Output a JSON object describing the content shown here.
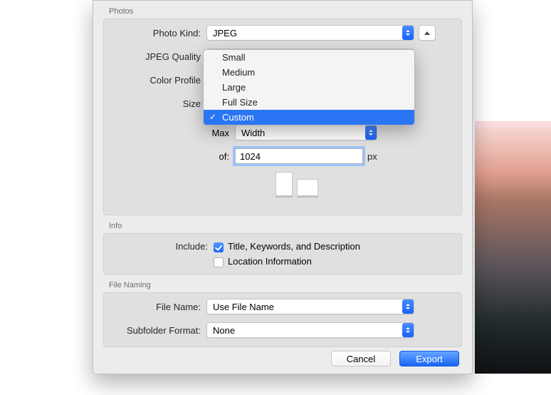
{
  "sections": {
    "photos": "Photos",
    "info": "Info",
    "fileNaming": "File Naming"
  },
  "photos": {
    "photoKindLabel": "Photo Kind:",
    "photoKindValue": "JPEG",
    "jpegQualityLabel": "JPEG Quality",
    "colorProfileLabel": "Color Profile",
    "sizeLabel": "Size",
    "maxLabel": "Max",
    "maxSelect": "Width",
    "ofLabel": "of:",
    "ofValue": "1024",
    "unit": "px"
  },
  "sizeOptions": [
    "Small",
    "Medium",
    "Large",
    "Full Size",
    "Custom"
  ],
  "sizeSelected": "Custom",
  "info": {
    "includeLabel": "Include:",
    "titleKeywords": "Title, Keywords, and Description",
    "location": "Location Information"
  },
  "fileNaming": {
    "fileNameLabel": "File Name:",
    "fileNameValue": "Use File Name",
    "subfolderLabel": "Subfolder Format:",
    "subfolderValue": "None"
  },
  "buttons": {
    "cancel": "Cancel",
    "export": "Export"
  }
}
